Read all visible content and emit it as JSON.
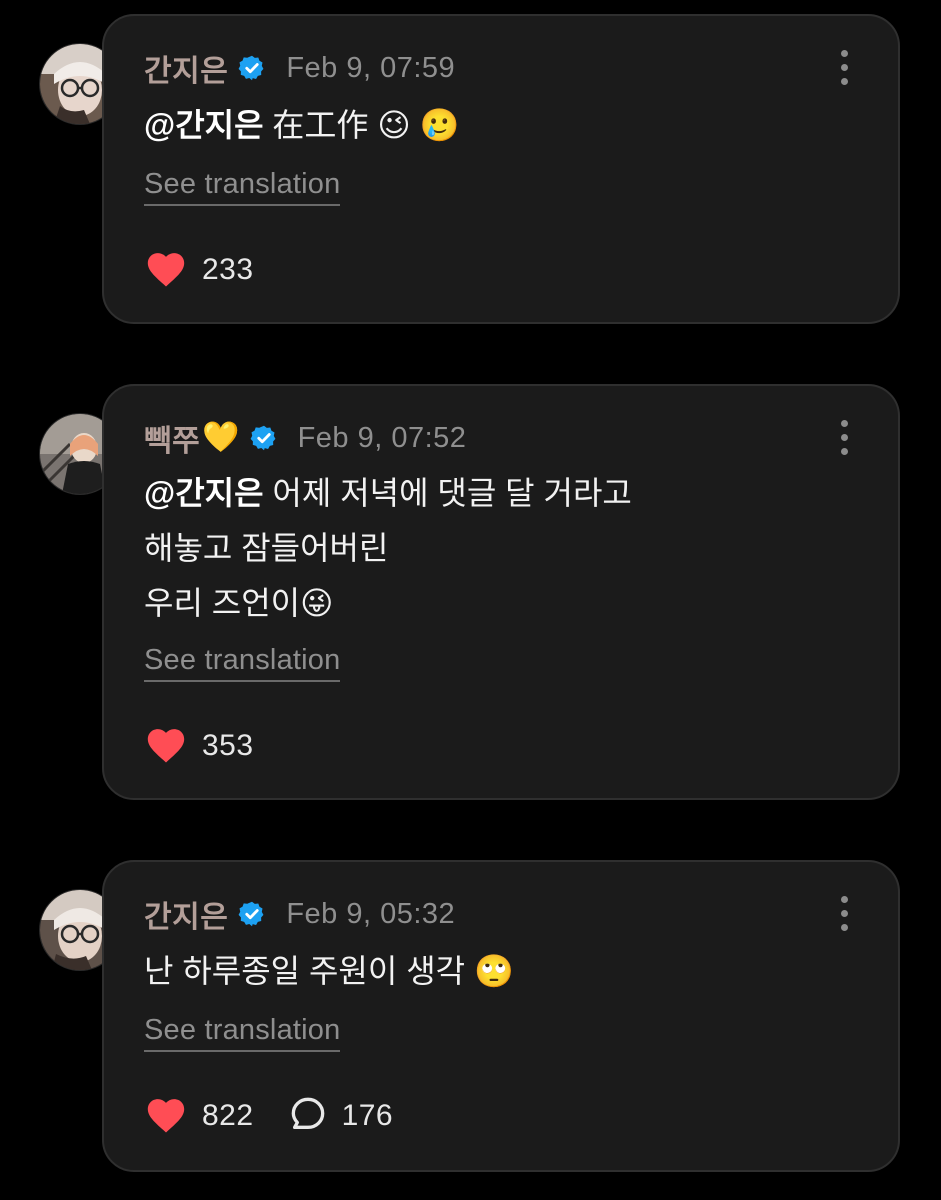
{
  "comments": [
    {
      "author": "간지은",
      "author_emoji": "",
      "verified": true,
      "timestamp": "Feb 9, 07:59",
      "mention": "@간지은",
      "text": " 在工作 ",
      "emojis": "😉 🥲",
      "see_translation": "See translation",
      "likes": "233",
      "replies": ""
    },
    {
      "author": "빽쭈",
      "author_emoji": "💛",
      "verified": true,
      "timestamp": "Feb 9, 07:52",
      "mention": "@간지은",
      "text": " 어제 저녁에 댓글 달 거라고\n해놓고 잠들어버린\n우리 즈언이",
      "emojis": "😜",
      "see_translation": "See translation",
      "likes": "353",
      "replies": ""
    },
    {
      "author": "간지은",
      "author_emoji": "",
      "verified": true,
      "timestamp": "Feb 9, 05:32",
      "mention": "",
      "text": "난 하루종일 주원이 생각 ",
      "emojis": "🙄",
      "see_translation": "See translation",
      "likes": "822",
      "replies": "176"
    }
  ],
  "icons": {
    "like": "heart-icon",
    "reply": "speech-bubble-icon",
    "verified": "verified-badge-icon",
    "more": "more-vertical-icon"
  },
  "colors": {
    "background": "#000000",
    "card": "#1b1b1b",
    "card_border": "#2f2f2f",
    "author": "#b39f99",
    "muted": "#8f8f8f",
    "heart": "#ff4d55",
    "verified": "#1da1f2"
  }
}
